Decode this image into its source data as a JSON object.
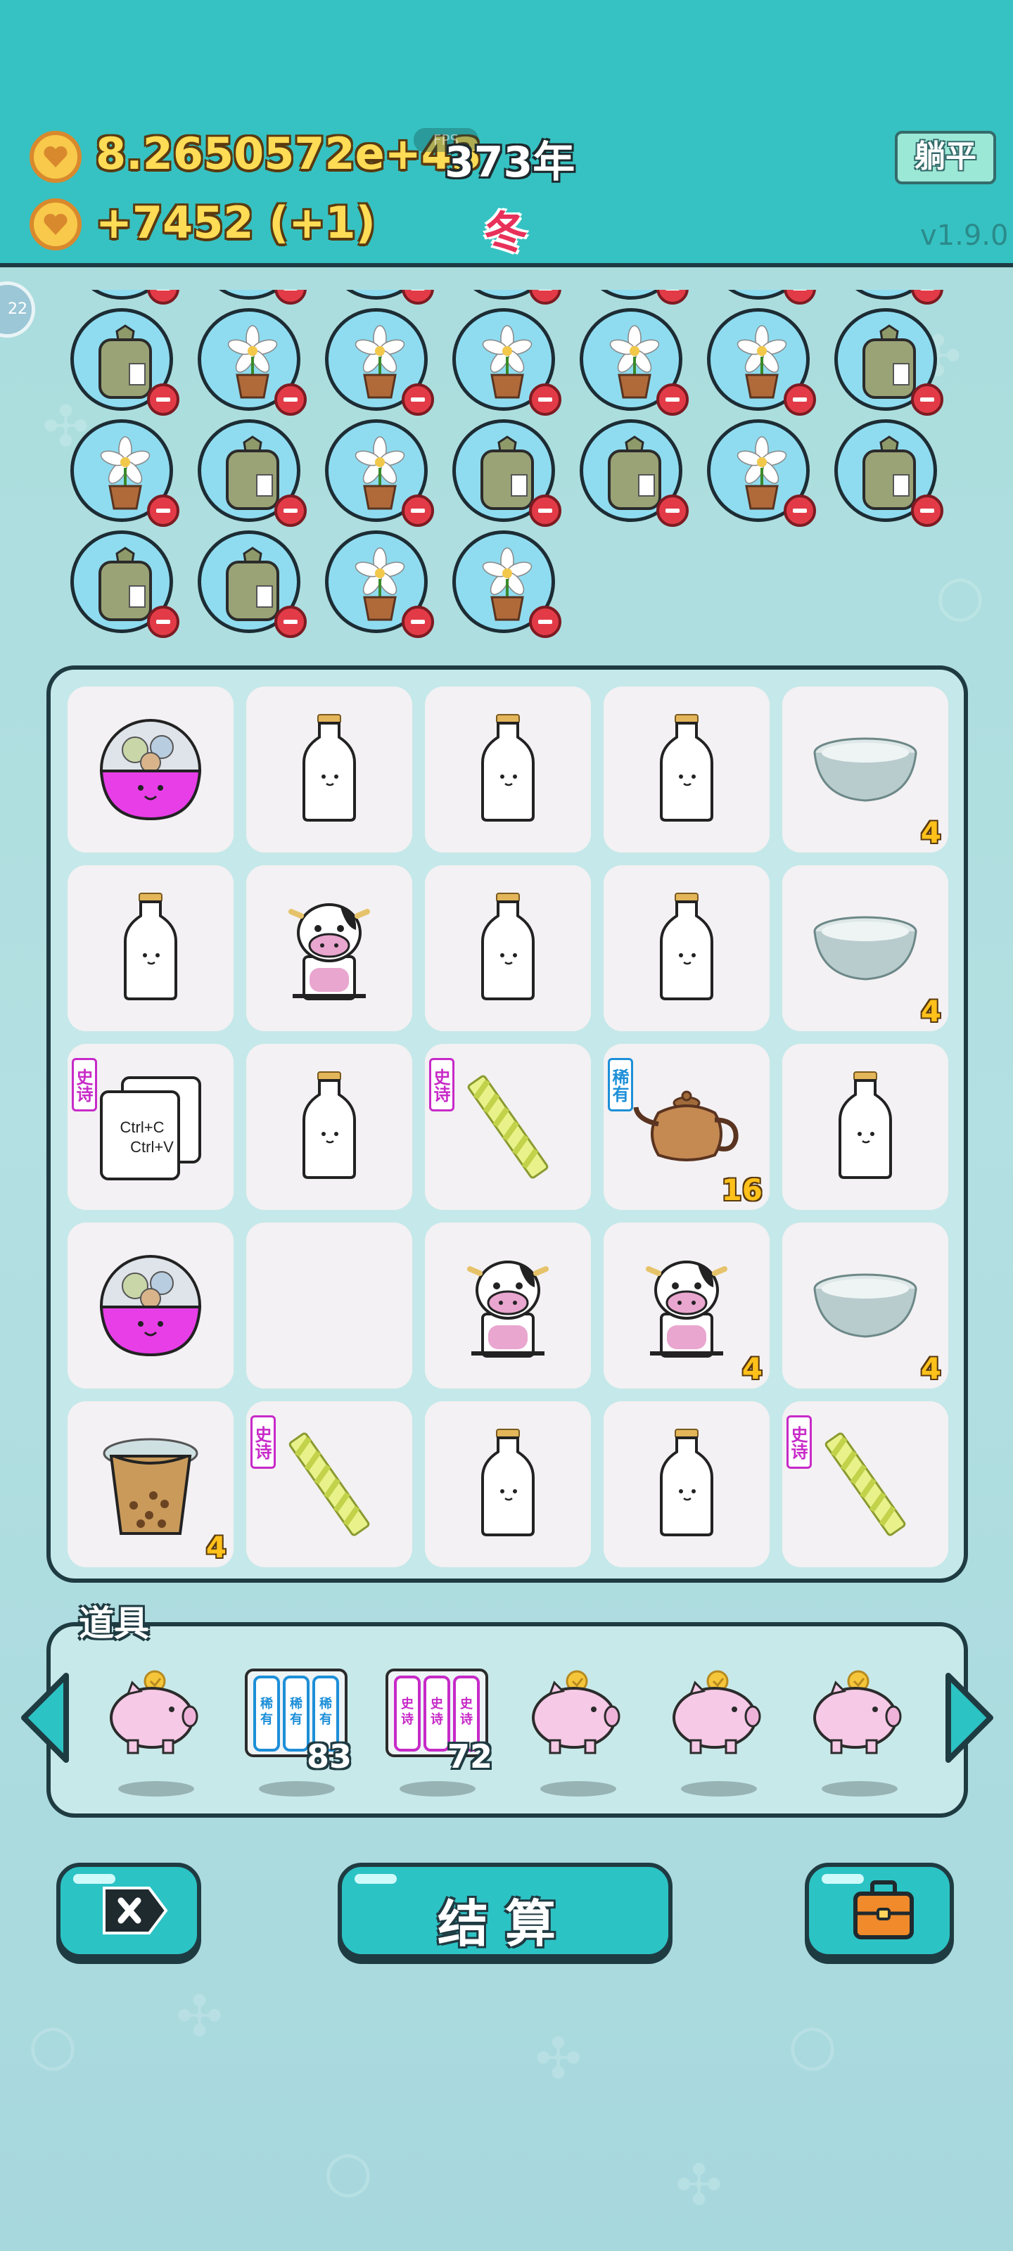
{
  "header": {
    "money": "8.2650572e+43",
    "income": "+7452 (+1)",
    "fps_label": "FPS",
    "year": "373年",
    "season": "冬",
    "lie_flat_label": "躺平",
    "version": "v1.9.0",
    "side_badge": "22"
  },
  "relics": {
    "rows": [
      [
        "bag",
        "flower",
        "flower",
        "flower",
        "flower",
        "flower",
        "bag"
      ],
      [
        "flower",
        "bag",
        "flower",
        "bag",
        "bag",
        "flower",
        "bag"
      ],
      [
        "bag",
        "bag",
        "flower",
        "flower"
      ]
    ]
  },
  "board": {
    "rows": [
      [
        {
          "item": "capsule",
          "count": "",
          "rarity": ""
        },
        {
          "item": "milk",
          "count": "",
          "rarity": ""
        },
        {
          "item": "milk",
          "count": "",
          "rarity": ""
        },
        {
          "item": "milk",
          "count": "",
          "rarity": ""
        },
        {
          "item": "bowl",
          "count": "4",
          "rarity": ""
        }
      ],
      [
        {
          "item": "milk",
          "count": "",
          "rarity": ""
        },
        {
          "item": "cow",
          "count": "",
          "rarity": ""
        },
        {
          "item": "milk",
          "count": "",
          "rarity": ""
        },
        {
          "item": "milk",
          "count": "",
          "rarity": ""
        },
        {
          "item": "bowl",
          "count": "4",
          "rarity": ""
        }
      ],
      [
        {
          "item": "copy-paste",
          "count": "",
          "rarity": "史诗"
        },
        {
          "item": "milk",
          "count": "",
          "rarity": ""
        },
        {
          "item": "straw",
          "count": "",
          "rarity": "史诗"
        },
        {
          "item": "teapot",
          "count": "16",
          "rarity": "稀有"
        },
        {
          "item": "milk",
          "count": "",
          "rarity": ""
        }
      ],
      [
        {
          "item": "capsule",
          "count": "",
          "rarity": ""
        },
        {
          "item": "empty",
          "count": "",
          "rarity": ""
        },
        {
          "item": "cow",
          "count": "",
          "rarity": ""
        },
        {
          "item": "cow",
          "count": "4",
          "rarity": ""
        },
        {
          "item": "bowl",
          "count": "4",
          "rarity": ""
        }
      ],
      [
        {
          "item": "bubble-tea",
          "count": "4",
          "rarity": ""
        },
        {
          "item": "straw",
          "count": "",
          "rarity": "史诗"
        },
        {
          "item": "milk",
          "count": "",
          "rarity": ""
        },
        {
          "item": "milk",
          "count": "",
          "rarity": ""
        },
        {
          "item": "straw",
          "count": "",
          "rarity": "史诗"
        }
      ]
    ],
    "copy_text_1": "Ctrl+C",
    "copy_text_2": "Ctrl+V"
  },
  "tools": {
    "title": "道具",
    "items": [
      {
        "item": "piggy-bank",
        "count": ""
      },
      {
        "item": "rare-card-pack",
        "count": "83",
        "tag": "稀有"
      },
      {
        "item": "epic-card-pack",
        "count": "72",
        "tag": "史诗"
      },
      {
        "item": "piggy-bank",
        "count": ""
      },
      {
        "item": "piggy-bank",
        "count": ""
      },
      {
        "item": "piggy-bank",
        "count": ""
      }
    ]
  },
  "buttons": {
    "settle_label": "结算"
  },
  "colors": {
    "header_bg": "#36c2c2",
    "coin_text": "#ffdc55",
    "season_red": "#e8315a",
    "epic": "#c72ac8",
    "rare": "#1d8fd8",
    "button_teal": "#2cc3c5"
  }
}
